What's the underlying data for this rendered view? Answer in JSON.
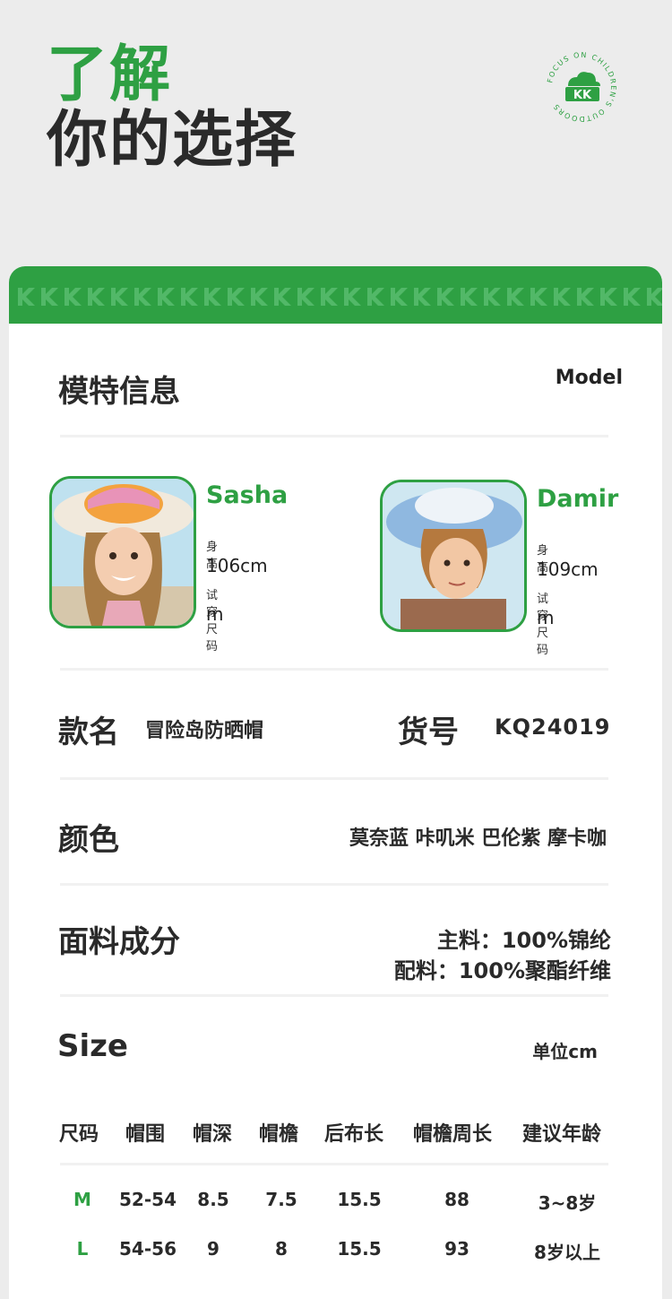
{
  "hero": {
    "line1": "了解",
    "line2": "你的选择"
  },
  "badge": {
    "logo": "KK",
    "ring_text": "FOCUS ON CHILDREN'S OUTDOORS"
  },
  "model_info": {
    "title": "模特信息",
    "label_en": "Model",
    "models": [
      {
        "name": "Sasha",
        "height_label": "身高",
        "height": "106cm",
        "size_label": "试穿尺码",
        "size": "m"
      },
      {
        "name": "Damir",
        "height_label": "身高",
        "height": "109cm",
        "size_label": "试穿尺码",
        "size": "m"
      }
    ]
  },
  "product": {
    "name_label": "款名",
    "name": "冒险岛防晒帽",
    "sku_label": "货号",
    "sku": "KQ24019",
    "color_label": "颜色",
    "colors": "莫奈蓝 咔叽米 巴伦紫 摩卡咖",
    "fabric_label": "面料成分",
    "fabric_main": "主料：100%锦纶",
    "fabric_lining": "配料：100%聚酯纤维"
  },
  "size": {
    "title": "Size",
    "unit": "单位cm",
    "headers": [
      "尺码",
      "帽围",
      "帽深",
      "帽檐",
      "后布长",
      "帽檐周长",
      "建议年龄"
    ],
    "rows": [
      [
        "M",
        "52-54",
        "8.5",
        "7.5",
        "15.5",
        "88",
        "3~8岁"
      ],
      [
        "L",
        "54-56",
        "9",
        "8",
        "15.5",
        "93",
        "8岁以上"
      ]
    ]
  },
  "colors": {
    "brand_green": "#2ea043",
    "text_dark": "#2a2a2a"
  }
}
